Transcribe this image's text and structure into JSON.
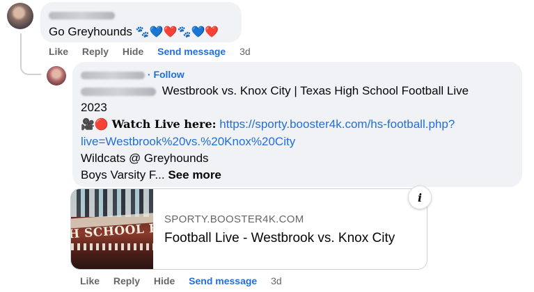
{
  "comment1": {
    "text": "Go Greyhounds",
    "emoji": "🐾💙❤️🐾💙❤️",
    "actions": {
      "like": "Like",
      "reply": "Reply",
      "hide": "Hide",
      "send_message": "Send message",
      "time": "3d"
    }
  },
  "comment2": {
    "follow_label": "· Follow",
    "title_line": "Westbrook vs. Knox City | Texas High School Football Live",
    "year_line": "2023",
    "emoji_prefix": "🎥🔴",
    "watch_label": "Watch Live here:",
    "link_line1": "https://sporty.booster4k.com/hs-football.php?",
    "link_line2": "live=Westbrook%20vs.%20Knox%20City",
    "line_matchup": "Wildcats @ Greyhounds",
    "line_truncated": "Boys Varsity F...",
    "see_more": "See more",
    "actions": {
      "like": "Like",
      "reply": "Reply",
      "hide": "Hide",
      "send_message": "Send message",
      "time": "3d"
    }
  },
  "link_card": {
    "thumbnail_text": "H SCHOOL FOO",
    "domain": "SPORTY.BOOSTER4K.COM",
    "title": "Football Live - Westbrook vs. Knox City",
    "info_glyph": "i"
  }
}
